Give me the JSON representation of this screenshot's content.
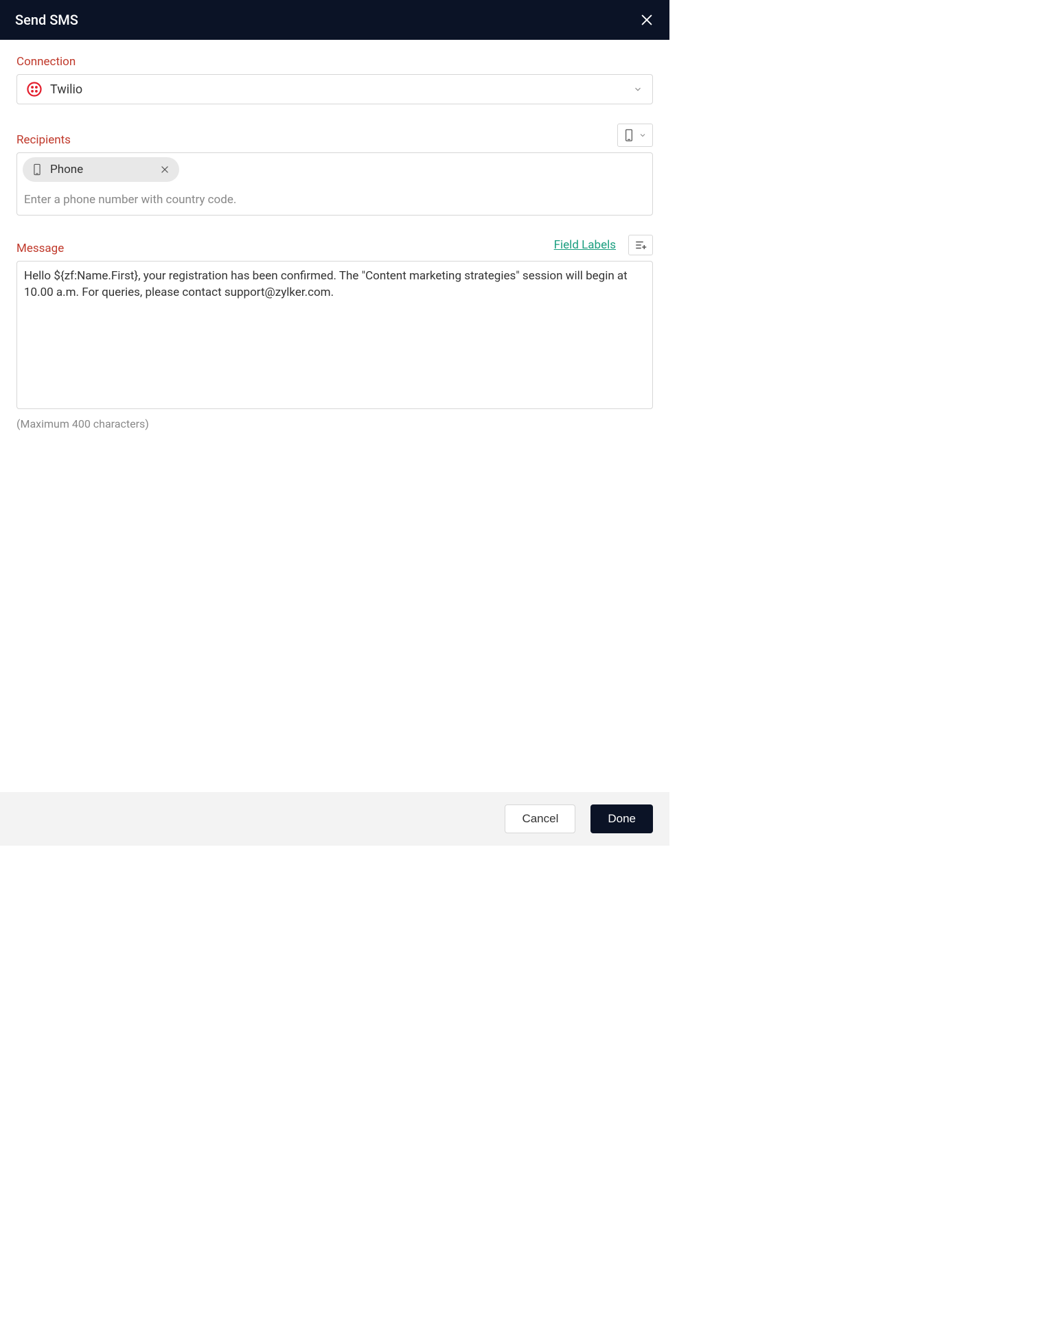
{
  "header": {
    "title": "Send SMS"
  },
  "connection": {
    "label": "Connection",
    "selected": "Twilio"
  },
  "recipients": {
    "label": "Recipients",
    "chip_label": "Phone",
    "placeholder": "Enter a phone number with country code."
  },
  "message": {
    "label": "Message",
    "field_labels_link": "Field Labels",
    "value": "Hello ${zf:Name.First}, your registration has been confirmed. The \"Content marketing strategies\" session will begin at 10.00 a.m. For queries, please contact support@zylker.com.",
    "helper": "(Maximum 400 characters)"
  },
  "footer": {
    "cancel": "Cancel",
    "done": "Done"
  }
}
